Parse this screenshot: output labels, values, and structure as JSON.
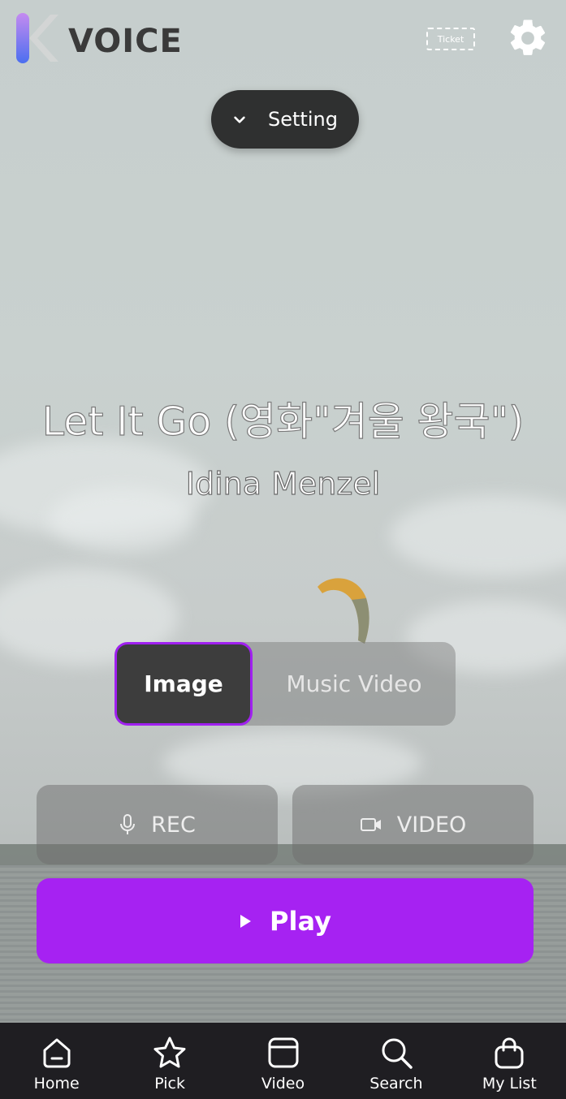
{
  "app": {
    "name": "VOICE"
  },
  "header": {
    "ticket_label": "Ticket",
    "settings_icon": "gear-icon"
  },
  "setting_pill": {
    "label": "Setting",
    "icon": "chevron-down-icon"
  },
  "song": {
    "title": "Let It Go (영화\"겨울 왕국\")",
    "artist": "Idina Menzel"
  },
  "media_toggle": {
    "options": [
      "Image",
      "Music Video"
    ],
    "selected": "Image"
  },
  "actions": {
    "rec_label": "REC",
    "video_label": "VIDEO",
    "play_label": "Play"
  },
  "colors": {
    "accent": "#A622F2",
    "pill_bg": "#2F3030",
    "nav_bg": "#1F1E22"
  },
  "nav": {
    "items": [
      {
        "label": "Home",
        "icon": "home-icon"
      },
      {
        "label": "Pick",
        "icon": "star-icon"
      },
      {
        "label": "Video",
        "icon": "video-tab-icon"
      },
      {
        "label": "Search",
        "icon": "search-icon"
      },
      {
        "label": "My List",
        "icon": "bag-icon"
      }
    ]
  }
}
